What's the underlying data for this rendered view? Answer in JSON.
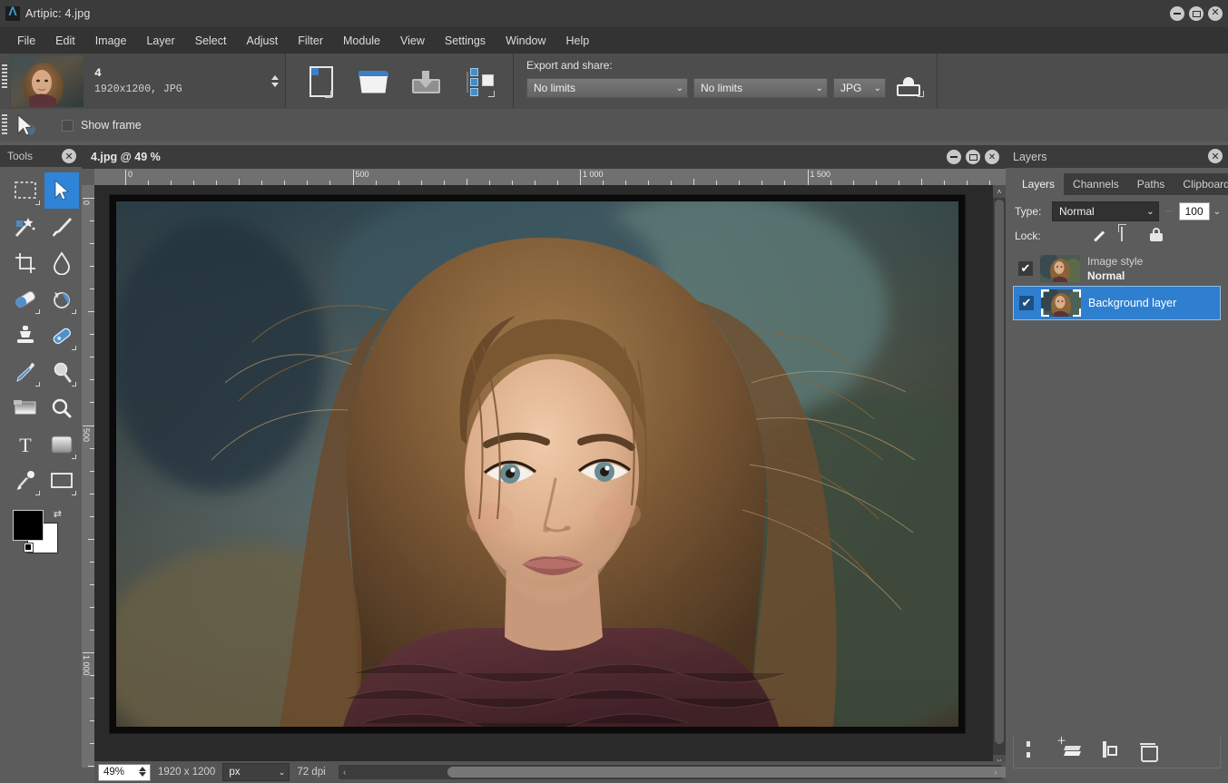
{
  "window": {
    "title": "Artipic: 4.jpg",
    "logo_icon": "lambda-logo-icon",
    "controls": [
      {
        "name": "minimize",
        "glyph": "–"
      },
      {
        "name": "maximize",
        "glyph": "▢"
      },
      {
        "name": "close",
        "glyph": "✕"
      }
    ]
  },
  "menu": {
    "items": [
      "File",
      "Edit",
      "Image",
      "Layer",
      "Select",
      "Adjust",
      "Filter",
      "Module",
      "View",
      "Settings",
      "Window",
      "Help"
    ]
  },
  "toolbar": {
    "file": {
      "name": "4",
      "dimensions": "1920x1200,  JPG"
    },
    "icons": [
      {
        "name": "new-document-icon",
        "label": "New"
      },
      {
        "name": "open-folder-icon",
        "label": "Open"
      },
      {
        "name": "save-icon",
        "label": "Save"
      },
      {
        "name": "module-icon",
        "label": "Module"
      }
    ],
    "export": {
      "label": "Export and share:",
      "size_limit": "No limits",
      "quality_limit": "No limits",
      "format": "JPG",
      "export_icon": "export-icon",
      "chevron": "⌄"
    }
  },
  "options_bar": {
    "cursor_icon": "arrow-cursor-icon",
    "show_frame_label": "Show frame",
    "show_frame_checked": false
  },
  "tools_panel": {
    "title": "Tools",
    "close_glyph": "✕",
    "tools": [
      {
        "name": "rectangular-marquee-tool",
        "selected": false
      },
      {
        "name": "move-tool",
        "selected": true
      },
      {
        "name": "magic-wand-tool",
        "selected": false
      },
      {
        "name": "brush-tool",
        "selected": false
      },
      {
        "name": "crop-tool",
        "selected": false
      },
      {
        "name": "blur-droplet-tool",
        "selected": false
      },
      {
        "name": "eraser-tool",
        "selected": false
      },
      {
        "name": "red-eye-tool",
        "selected": false
      },
      {
        "name": "clone-stamp-tool",
        "selected": false
      },
      {
        "name": "healing-patch-tool",
        "selected": false
      },
      {
        "name": "eyedropper-tool",
        "selected": false
      },
      {
        "name": "dodge-tool",
        "selected": false
      },
      {
        "name": "gradient-tool",
        "selected": false
      },
      {
        "name": "zoom-tool",
        "selected": false
      },
      {
        "name": "text-tool",
        "selected": false
      },
      {
        "name": "shape-fill-tool",
        "selected": false
      },
      {
        "name": "pen-tool",
        "selected": false
      },
      {
        "name": "rectangle-shape-tool",
        "selected": false
      }
    ],
    "color_swatch": {
      "foreground": "#000000",
      "background": "#ffffff",
      "swap_icon": "swap-colors-icon",
      "default_icon": "default-colors-icon"
    }
  },
  "document": {
    "title": "4.jpg @ 49 %",
    "controls": [
      {
        "name": "doc-minimize",
        "glyph": "–"
      },
      {
        "name": "doc-restore",
        "glyph": "▢"
      },
      {
        "name": "doc-close",
        "glyph": "✕"
      }
    ],
    "ruler_h_labels": [
      "0",
      "500",
      "1 000",
      "1 500"
    ],
    "ruler_v_labels": [
      "0",
      "500",
      "1 000"
    ]
  },
  "status_bar": {
    "zoom": "49%",
    "image_size": "1920 x 1200",
    "unit": "px",
    "dpi": "72 dpi",
    "scroll_left_glyph": "‹",
    "scroll_right_glyph": "›"
  },
  "layers_panel": {
    "title": "Layers",
    "close_glyph": "✕",
    "tabs": [
      {
        "label": "Layers",
        "active": true
      },
      {
        "label": "Channels",
        "active": false
      },
      {
        "label": "Paths",
        "active": false
      },
      {
        "label": "Clipboard",
        "active": false
      }
    ],
    "type_label": "Type:",
    "type_value": "Normal",
    "opacity_value": "100",
    "lock_label": "Lock:",
    "lock_icons": [
      {
        "name": "lock-transparency-icon"
      },
      {
        "name": "lock-paint-icon"
      },
      {
        "name": "lock-move-icon"
      },
      {
        "name": "lock-all-icon"
      }
    ],
    "layers": [
      {
        "name_line1": "Image style",
        "name_line2": "Normal",
        "visible": true,
        "selected": false,
        "check_glyph": "✔"
      },
      {
        "name_line1": "Background layer",
        "name_line2": "",
        "visible": true,
        "selected": true,
        "check_glyph": "✔"
      }
    ],
    "footer_buttons": [
      {
        "name": "add-mask-button"
      },
      {
        "name": "new-layer-button"
      },
      {
        "name": "duplicate-layer-button"
      },
      {
        "name": "delete-layer-button"
      }
    ]
  },
  "colors": {
    "accent": "#2f7fd0",
    "titlebar": "#3b3b3b",
    "panel": "#5c5c5c",
    "toolbar": "#4d4d4d",
    "canvas_bg": "#2a2a2a"
  }
}
